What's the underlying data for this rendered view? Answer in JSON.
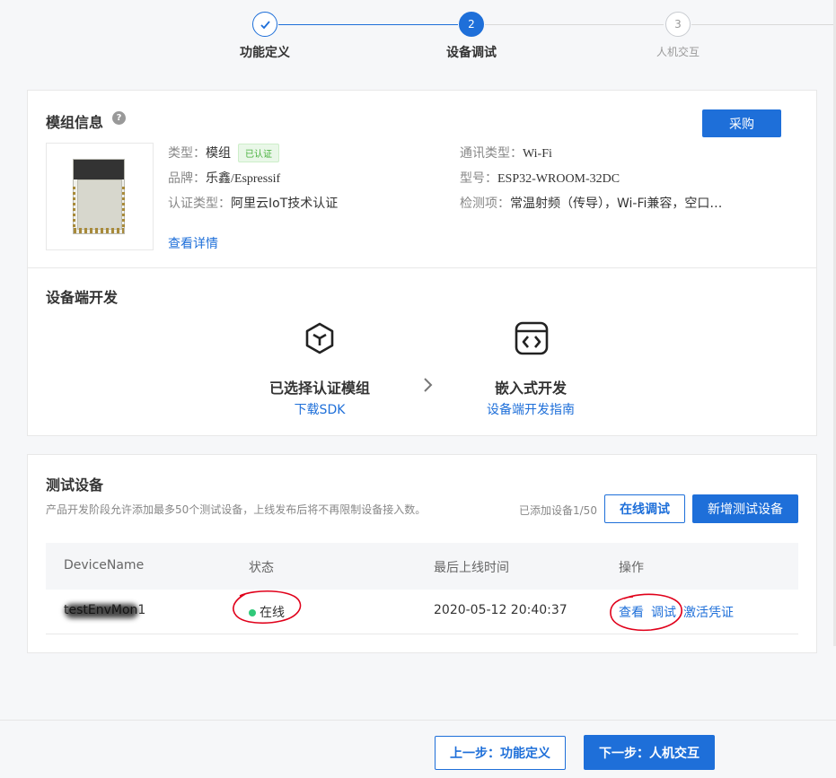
{
  "stepper": {
    "steps": [
      {
        "label": "功能定义",
        "state": "done",
        "number": "✓"
      },
      {
        "label": "设备调试",
        "state": "active",
        "number": "2"
      },
      {
        "label": "人机交互",
        "state": "todo",
        "number": "3"
      }
    ]
  },
  "module": {
    "title": "模组信息",
    "help_icon": "?",
    "buy_label": "采购",
    "type_key": "类型：",
    "type_val": "模组",
    "certified_badge": "已认证",
    "brand_key": "品牌：",
    "brand_val": "乐鑫/Espressif",
    "cert_key": "认证类型：",
    "cert_val": "阿里云IoT技术认证",
    "comm_key": "通讯类型：",
    "comm_val": "Wi-Fi",
    "model_key": "型号：",
    "model_val": "ESP32-WROOM-32DC",
    "test_key": "检测项：",
    "test_val": "常温射频（传导），Wi-Fi兼容，空口…",
    "details_link": "查看详情"
  },
  "device_dev": {
    "title": "设备端开发",
    "left_title": "已选择认证模组",
    "left_link": "下载SDK",
    "right_title": "嵌入式开发",
    "right_link": "设备端开发指南"
  },
  "test_devices": {
    "title": "测试设备",
    "description": "产品开发阶段允许添加最多50个测试设备，上线发布后将不再限制设备接入数。",
    "count": "已添加设备1/50",
    "online_debug_label": "在线调试",
    "add_device_label": "新增测试设备",
    "columns": [
      "DeviceName",
      "状态",
      "最后上线时间",
      "操作"
    ],
    "rows": [
      {
        "name": "testEnvMon1",
        "status": "在线",
        "last_online": "2020-05-12 20:40:37",
        "actions": [
          "查看",
          "调试",
          "激活凭证"
        ]
      }
    ]
  },
  "footer": {
    "prev_label": "上一步：功能定义",
    "next_label": "下一步：人机交互"
  },
  "colors": {
    "accent": "#1e6fd9",
    "success": "#30c97a",
    "annotation": "#e0001a"
  }
}
